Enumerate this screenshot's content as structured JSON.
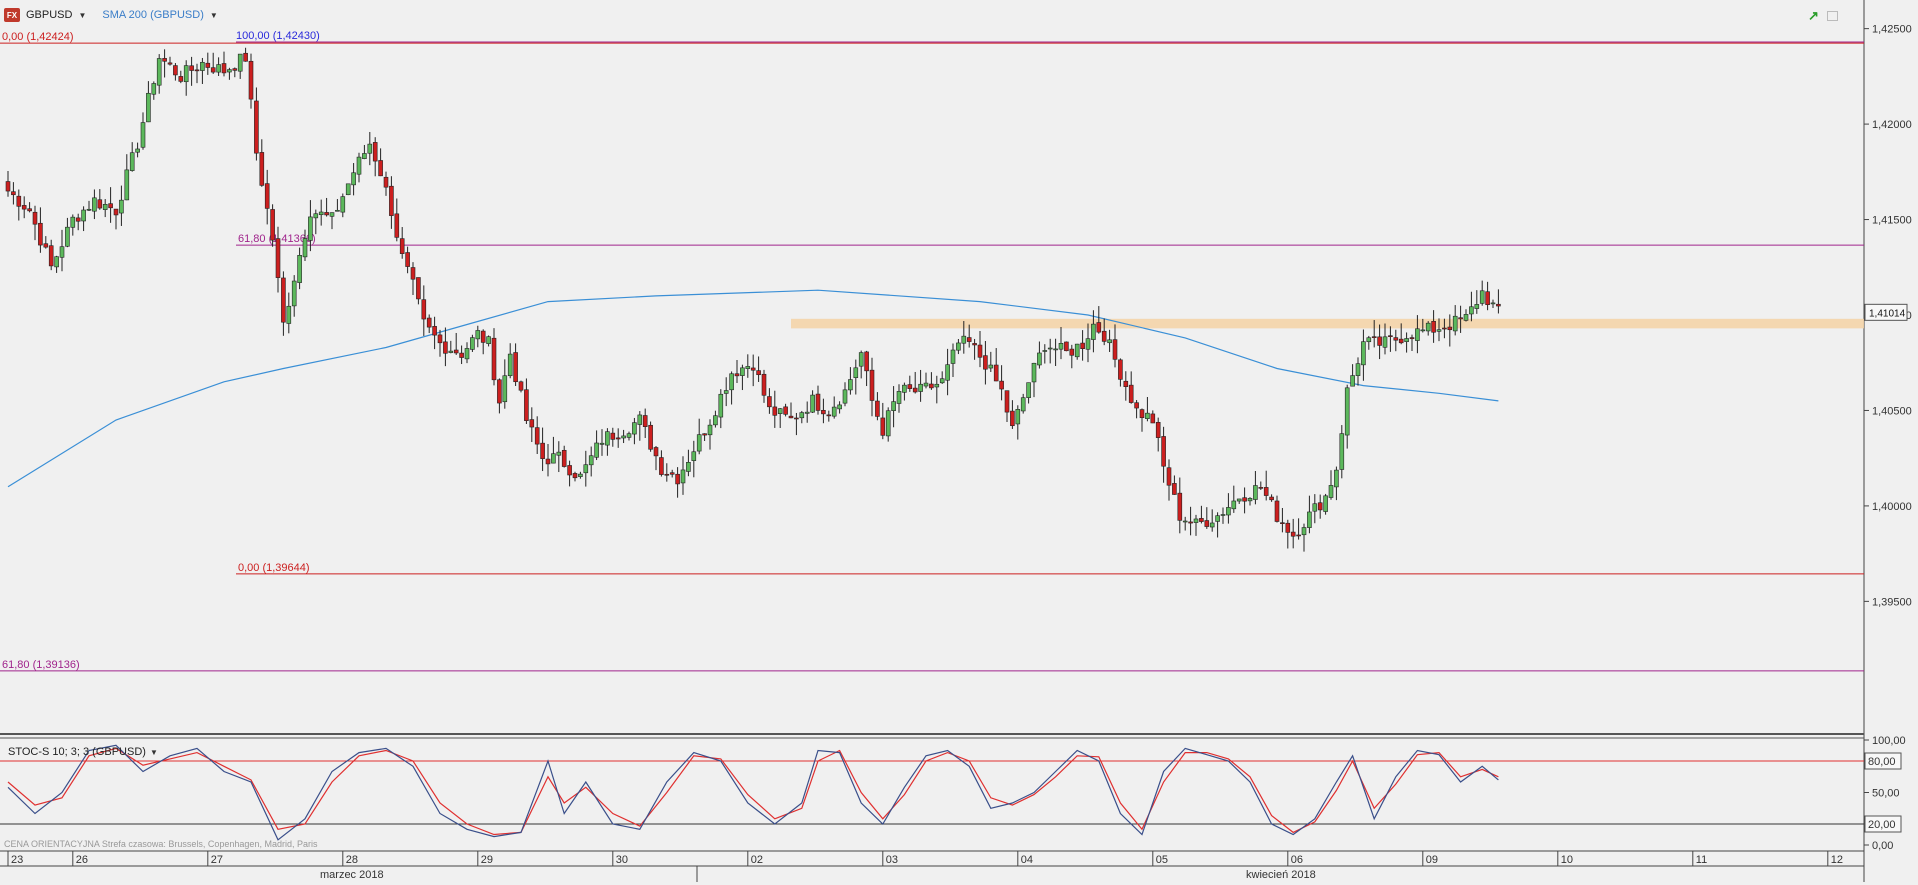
{
  "header": {
    "symbol": "GBPUSD",
    "indicator": "SMA 200 (GBPUSD)"
  },
  "stochastic_header": "STOC-S 10; 3; 3 (GBPUSD)",
  "footer_text": "CENA ORIENTACYJNA   Strefa czasowa: Brussels, Copenhagen, Madrid, Paris",
  "colors": {
    "bull": "#5cb85c",
    "bear": "#cc1f1f",
    "sma": "#3a8fd6",
    "fib": "#a0248c",
    "zone": "#f5d2a4",
    "stoch_k": "#3a4f8a",
    "stoch_d": "#e03030"
  },
  "chart_data": [
    {
      "type": "candlestick",
      "symbol": "GBPUSD",
      "ylim": [
        1.388,
        1.4265
      ],
      "yticks": [
        "1,42500",
        "1,42000",
        "1,41500",
        "1,41000",
        "1,40500",
        "1,40000",
        "1,39500"
      ],
      "last_price_label": "1,41014",
      "last_price": 1.41014,
      "x_day_labels": [
        "23",
        "26",
        "27",
        "28",
        "29",
        "30",
        "02",
        "03",
        "04",
        "05",
        "06",
        "09",
        "10",
        "11",
        "12"
      ],
      "month_labels": [
        "marzec 2018",
        "kwiecień 2018"
      ],
      "fib_levels": [
        {
          "label": "0,00 (1,42424)",
          "value": 1.42424
        },
        {
          "label": "100,00 (1,42430)",
          "value": 1.4243
        },
        {
          "label": "61,80 (1,41366)",
          "value": 1.41366
        },
        {
          "label": "0,00 (1,39644)",
          "value": 1.39644
        },
        {
          "label": "61,80 (1,39136)",
          "value": 1.39136
        }
      ],
      "resistance_zone": [
        1.4093,
        1.4098
      ],
      "anchors": [
        [
          0,
          1.4165
        ],
        [
          4,
          1.4155
        ],
        [
          8,
          1.4125
        ],
        [
          12,
          1.415
        ],
        [
          16,
          1.416
        ],
        [
          20,
          1.4155
        ],
        [
          24,
          1.419
        ],
        [
          28,
          1.4235
        ],
        [
          32,
          1.4225
        ],
        [
          36,
          1.4232
        ],
        [
          40,
          1.4228
        ],
        [
          44,
          1.4235
        ],
        [
          46,
          1.4185
        ],
        [
          49,
          1.414
        ],
        [
          51,
          1.4095
        ],
        [
          53,
          1.412
        ],
        [
          56,
          1.4155
        ],
        [
          60,
          1.415
        ],
        [
          64,
          1.4175
        ],
        [
          67,
          1.419
        ],
        [
          69,
          1.4175
        ],
        [
          71,
          1.4155
        ],
        [
          73,
          1.413
        ],
        [
          75,
          1.4115
        ],
        [
          77,
          1.4095
        ],
        [
          80,
          1.4085
        ],
        [
          84,
          1.408
        ],
        [
          87,
          1.409
        ],
        [
          89,
          1.4085
        ],
        [
          91,
          1.4055
        ],
        [
          93,
          1.408
        ],
        [
          96,
          1.4045
        ],
        [
          99,
          1.4025
        ],
        [
          102,
          1.4025
        ],
        [
          106,
          1.4015
        ],
        [
          110,
          1.4035
        ],
        [
          114,
          1.404
        ],
        [
          117,
          1.4045
        ],
        [
          121,
          1.402
        ],
        [
          124,
          1.4015
        ],
        [
          127,
          1.403
        ],
        [
          130,
          1.4045
        ],
        [
          134,
          1.407
        ],
        [
          138,
          1.4075
        ],
        [
          141,
          1.405
        ],
        [
          145,
          1.4045
        ],
        [
          149,
          1.4055
        ],
        [
          152,
          1.405
        ],
        [
          155,
          1.406
        ],
        [
          158,
          1.408
        ],
        [
          160,
          1.4055
        ],
        [
          162,
          1.404
        ],
        [
          165,
          1.406
        ],
        [
          169,
          1.406
        ],
        [
          173,
          1.4065
        ],
        [
          176,
          1.4085
        ],
        [
          178,
          1.4085
        ],
        [
          181,
          1.4075
        ],
        [
          184,
          1.406
        ],
        [
          186,
          1.404
        ],
        [
          189,
          1.4065
        ],
        [
          192,
          1.4085
        ],
        [
          196,
          1.408
        ],
        [
          199,
          1.4085
        ],
        [
          201,
          1.4095
        ],
        [
          203,
          1.409
        ],
        [
          206,
          1.407
        ],
        [
          209,
          1.405
        ],
        [
          212,
          1.4045
        ],
        [
          214,
          1.402
        ],
        [
          217,
          1.3995
        ],
        [
          220,
          1.399
        ],
        [
          224,
          1.3995
        ],
        [
          228,
          1.4005
        ],
        [
          232,
          1.401
        ],
        [
          235,
          1.3995
        ],
        [
          238,
          1.3985
        ],
        [
          241,
          1.3995
        ],
        [
          244,
          1.4005
        ],
        [
          246,
          1.402
        ],
        [
          248,
          1.406
        ],
        [
          251,
          1.4085
        ],
        [
          255,
          1.4085
        ],
        [
          259,
          1.409
        ],
        [
          263,
          1.4092
        ],
        [
          267,
          1.4095
        ],
        [
          270,
          1.4098
        ],
        [
          273,
          1.4112
        ],
        [
          276,
          1.4101
        ]
      ],
      "sma_200": [
        [
          0,
          1.401
        ],
        [
          20,
          1.4045
        ],
        [
          40,
          1.4065
        ],
        [
          51,
          1.4072
        ],
        [
          70,
          1.4083
        ],
        [
          85,
          1.4095
        ],
        [
          100,
          1.4107
        ],
        [
          120,
          1.411
        ],
        [
          150,
          1.4113
        ],
        [
          180,
          1.4107
        ],
        [
          200,
          1.41
        ],
        [
          218,
          1.4088
        ],
        [
          235,
          1.4072
        ],
        [
          251,
          1.4063
        ],
        [
          265,
          1.4059
        ],
        [
          276,
          1.4055
        ]
      ]
    },
    {
      "type": "line",
      "title": "STOC-S 10; 3; 3 (GBPUSD)",
      "ylim": [
        0,
        100
      ],
      "yticks": [
        "100,00",
        "80,00",
        "50,00",
        "20,00",
        "0,00"
      ],
      "levels": [
        80,
        20
      ],
      "k": [
        [
          0,
          55
        ],
        [
          5,
          30
        ],
        [
          10,
          50
        ],
        [
          15,
          90
        ],
        [
          20,
          95
        ],
        [
          25,
          70
        ],
        [
          30,
          85
        ],
        [
          35,
          92
        ],
        [
          40,
          70
        ],
        [
          45,
          60
        ],
        [
          50,
          5
        ],
        [
          55,
          25
        ],
        [
          60,
          70
        ],
        [
          65,
          88
        ],
        [
          70,
          92
        ],
        [
          75,
          75
        ],
        [
          80,
          30
        ],
        [
          85,
          15
        ],
        [
          90,
          8
        ],
        [
          95,
          12
        ],
        [
          100,
          80
        ],
        [
          103,
          30
        ],
        [
          107,
          60
        ],
        [
          112,
          20
        ],
        [
          117,
          15
        ],
        [
          122,
          60
        ],
        [
          127,
          88
        ],
        [
          132,
          80
        ],
        [
          137,
          40
        ],
        [
          142,
          20
        ],
        [
          147,
          40
        ],
        [
          150,
          90
        ],
        [
          154,
          88
        ],
        [
          158,
          40
        ],
        [
          162,
          20
        ],
        [
          166,
          55
        ],
        [
          170,
          85
        ],
        [
          174,
          90
        ],
        [
          178,
          75
        ],
        [
          182,
          35
        ],
        [
          186,
          40
        ],
        [
          190,
          50
        ],
        [
          194,
          70
        ],
        [
          198,
          90
        ],
        [
          202,
          80
        ],
        [
          206,
          30
        ],
        [
          210,
          10
        ],
        [
          214,
          70
        ],
        [
          218,
          92
        ],
        [
          222,
          86
        ],
        [
          226,
          80
        ],
        [
          230,
          60
        ],
        [
          234,
          20
        ],
        [
          238,
          10
        ],
        [
          242,
          25
        ],
        [
          246,
          60
        ],
        [
          249,
          85
        ],
        [
          253,
          25
        ],
        [
          257,
          65
        ],
        [
          261,
          90
        ],
        [
          265,
          86
        ],
        [
          269,
          60
        ],
        [
          273,
          75
        ],
        [
          276,
          62
        ]
      ],
      "d": [
        [
          0,
          60
        ],
        [
          5,
          38
        ],
        [
          10,
          45
        ],
        [
          15,
          85
        ],
        [
          20,
          92
        ],
        [
          25,
          76
        ],
        [
          30,
          82
        ],
        [
          35,
          88
        ],
        [
          40,
          75
        ],
        [
          45,
          62
        ],
        [
          50,
          15
        ],
        [
          55,
          20
        ],
        [
          60,
          60
        ],
        [
          65,
          85
        ],
        [
          70,
          90
        ],
        [
          75,
          80
        ],
        [
          80,
          40
        ],
        [
          85,
          20
        ],
        [
          90,
          10
        ],
        [
          95,
          12
        ],
        [
          100,
          65
        ],
        [
          103,
          40
        ],
        [
          107,
          55
        ],
        [
          112,
          30
        ],
        [
          117,
          18
        ],
        [
          122,
          50
        ],
        [
          127,
          85
        ],
        [
          132,
          82
        ],
        [
          137,
          48
        ],
        [
          142,
          25
        ],
        [
          147,
          35
        ],
        [
          150,
          80
        ],
        [
          154,
          90
        ],
        [
          158,
          50
        ],
        [
          162,
          25
        ],
        [
          166,
          48
        ],
        [
          170,
          80
        ],
        [
          174,
          88
        ],
        [
          178,
          80
        ],
        [
          182,
          45
        ],
        [
          186,
          38
        ],
        [
          190,
          48
        ],
        [
          194,
          65
        ],
        [
          198,
          85
        ],
        [
          202,
          84
        ],
        [
          206,
          40
        ],
        [
          210,
          15
        ],
        [
          214,
          60
        ],
        [
          218,
          88
        ],
        [
          222,
          88
        ],
        [
          226,
          82
        ],
        [
          230,
          65
        ],
        [
          234,
          28
        ],
        [
          238,
          12
        ],
        [
          242,
          22
        ],
        [
          246,
          52
        ],
        [
          249,
          80
        ],
        [
          253,
          35
        ],
        [
          257,
          58
        ],
        [
          261,
          86
        ],
        [
          265,
          88
        ],
        [
          269,
          65
        ],
        [
          273,
          72
        ],
        [
          276,
          65
        ]
      ]
    }
  ]
}
